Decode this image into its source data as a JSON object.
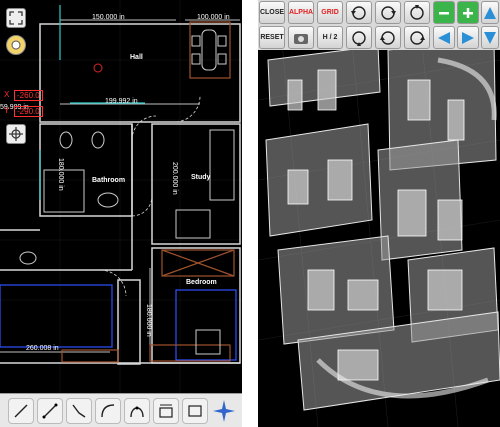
{
  "plan": {
    "dimensions": {
      "top": "150.000 in",
      "top_right": "100.000 in",
      "hall_bottom": "199.992 in",
      "bath_vertical": "180.000 in",
      "study_vertical": "200.000 in",
      "bedroom_vertical": "180.000 in",
      "bottom_left": "260.008 in",
      "left_side": "59.989 in"
    },
    "rooms": {
      "hall": "Hall",
      "bathroom": "Bathroom",
      "study": "Study",
      "bedroom": "Bedroom"
    },
    "coords": {
      "x_label": "X",
      "x_value": "-260.0",
      "y_label": "Y",
      "y_value": "-290.0"
    }
  },
  "toolbar": {
    "tools": [
      "select-tool-icon",
      "line-tool-icon",
      "polyline-tool-icon",
      "arc-tool-icon",
      "curve-tool-icon",
      "wall-tool-icon",
      "rectangle-tool-icon",
      "compass-tool-icon"
    ]
  },
  "controls": {
    "close": "CLOSE",
    "alpha": "ALPHA",
    "grid": "GRID",
    "reset": "RESET",
    "half": "H / 2"
  },
  "colors": {
    "accent_red": "#dd2222",
    "zoom_green": "#3bb54a",
    "arrow_blue": "#2b8fd6"
  }
}
